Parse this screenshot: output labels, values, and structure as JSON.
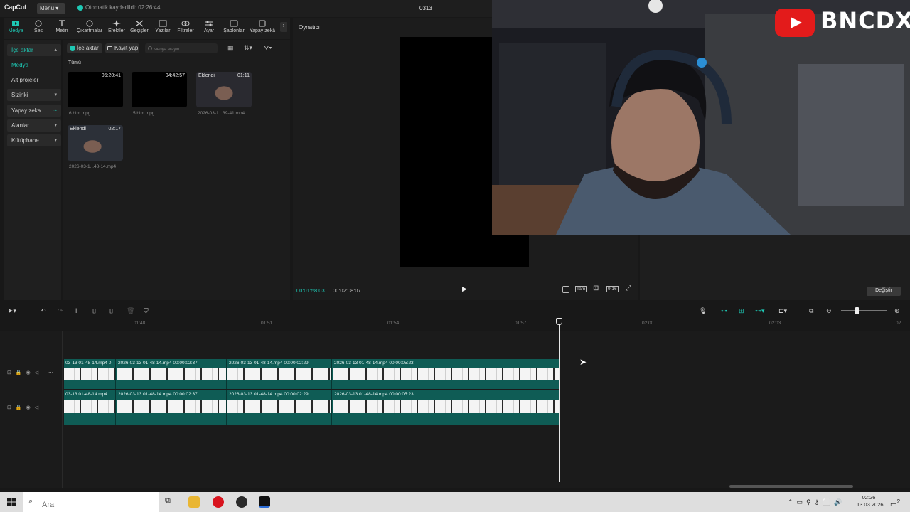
{
  "app": {
    "logo": "CapCut",
    "menu_label": "Menü",
    "autosave": "Otomatik kaydedildi: 02:26:44",
    "project_title": "0313"
  },
  "toolbar": [
    {
      "label": "Medya",
      "icon": "media-icon",
      "active": true
    },
    {
      "label": "Ses",
      "icon": "audio-icon"
    },
    {
      "label": "Metin",
      "icon": "text-icon"
    },
    {
      "label": "Çıkartmalar",
      "icon": "sticker-icon"
    },
    {
      "label": "Efektler",
      "icon": "effects-icon"
    },
    {
      "label": "Geçişler",
      "icon": "transitions-icon"
    },
    {
      "label": "Yazılar",
      "icon": "captions-icon"
    },
    {
      "label": "Filtreler",
      "icon": "filters-icon"
    },
    {
      "label": "Ayar",
      "icon": "adjust-icon"
    },
    {
      "label": "Şablonlar",
      "icon": "templates-icon"
    },
    {
      "label": "Yapay zekâ",
      "icon": "ai-icon"
    }
  ],
  "left_nav": {
    "import": "İçe aktar",
    "media": "Medya",
    "sub_projects": "Alt projeler",
    "yours": "Sizinki",
    "ai": "Yapay zeka ...",
    "spaces": "Alanlar",
    "library": "Kütüphane"
  },
  "media_panel": {
    "import_button": "İçe aktar",
    "record_button": "Kayıt yap",
    "search_placeholder": "Medya arayın",
    "filter_all": "Tümü",
    "items": [
      {
        "name": "6.blm.mpg",
        "duration": "05:20:41",
        "tag": ""
      },
      {
        "name": "5.blm.mpg",
        "duration": "04:42:57",
        "tag": ""
      },
      {
        "name": "2026-03-1...39-41.mp4",
        "duration": "01:11",
        "tag": "Eklendi"
      },
      {
        "name": "2026-03-1...48-14.mp4",
        "duration": "02:17",
        "tag": "Eklendi"
      }
    ]
  },
  "player": {
    "title": "Oynatıcı",
    "current_time": "00:01:58:03",
    "total_time": "00:02:08:07",
    "quality": "Tam",
    "ratio": "9:16"
  },
  "details": {
    "change_button": "Değiştir"
  },
  "overlay": {
    "channel_text": "BNCDX"
  },
  "timeline": {
    "ticks": [
      "01:48",
      "01:51",
      "01:54",
      "01:57",
      "02:00",
      "02:03",
      "02"
    ],
    "tracks": [
      {
        "clips": [
          {
            "label": "03-13 01-48-14.mp4  0"
          },
          {
            "label": "2026-03-13 01-48-14.mp4  00:00:02:37"
          },
          {
            "label": "2026-03-13 01-48-14.mp4  00:00:02:29"
          },
          {
            "label": "2026-03-13 01-48-14.mp4  00:00:05:23"
          }
        ]
      },
      {
        "clips": [
          {
            "label": "03-13 01-48-14.mp4"
          },
          {
            "label": "2026-03-13 01-48-14.mp4  00:00:02:37"
          },
          {
            "label": "2026-03-13 01-48-14.mp4  00:00:02:29"
          },
          {
            "label": "2026-03-13 01-48-14.mp4  00:00:05:23"
          }
        ]
      }
    ]
  },
  "taskbar": {
    "search_placeholder": "Ara",
    "time": "02:26",
    "date": "13.03.2026",
    "notification_count": "2"
  },
  "colors": {
    "accent": "#1ec8b4",
    "track": "#0f5c55",
    "youtube": "#e31b1b"
  }
}
